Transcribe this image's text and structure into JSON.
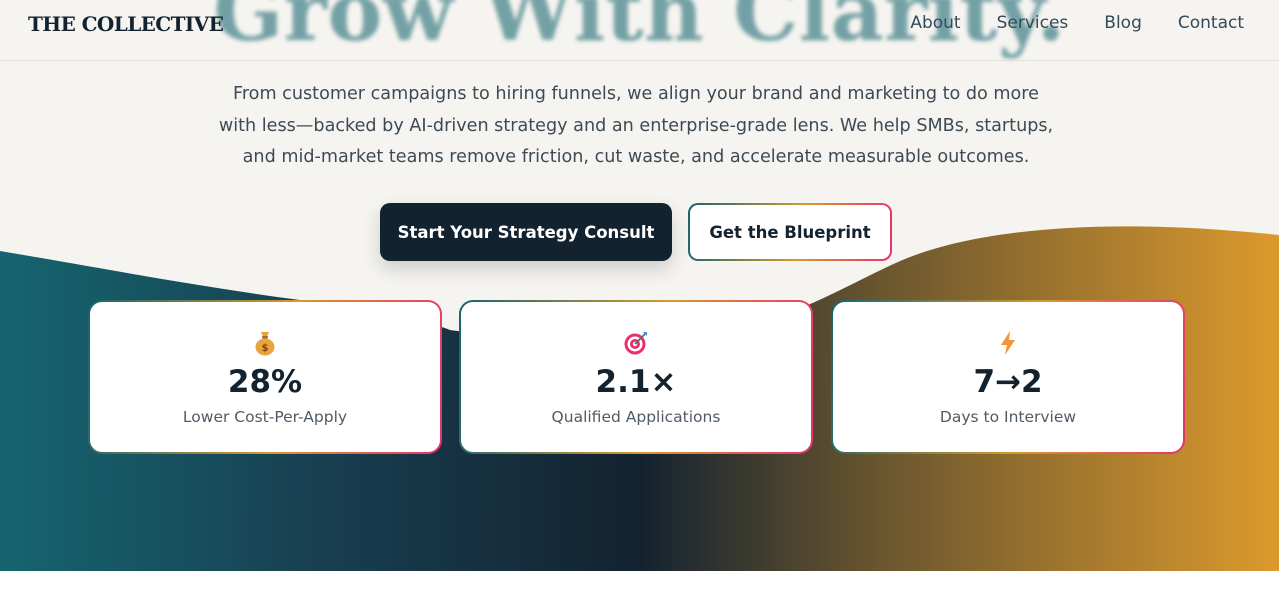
{
  "brand": {
    "name": "THE COLLECTIVE"
  },
  "nav": {
    "items": [
      "About",
      "Services",
      "Blog",
      "Contact"
    ]
  },
  "hero": {
    "title": "Grow With Clarity.",
    "lines": [
      "From customer campaigns to hiring funnels, we align your brand and marketing to do more",
      "with less—backed by AI-driven strategy and an enterprise-grade lens. We help SMBs, startups,",
      "and mid-market teams remove friction, cut waste, and accelerate measurable outcomes."
    ],
    "primary_cta": "Start Your Strategy Consult",
    "secondary_cta": "Get the Blueprint"
  },
  "stats": [
    {
      "icon": "money-bag-icon",
      "value": "28%",
      "label": "Lower Cost-Per-Apply"
    },
    {
      "icon": "target-icon",
      "value": "2.1×",
      "label": "Qualified Applications"
    },
    {
      "icon": "lightning-icon",
      "value": "7→2",
      "label": "Days to Interview"
    }
  ],
  "colors": {
    "navy": "#13222f",
    "teal": "#15656f",
    "gold": "#d69a2d",
    "pink": "#e8306f",
    "background": "#f6f4f0"
  }
}
